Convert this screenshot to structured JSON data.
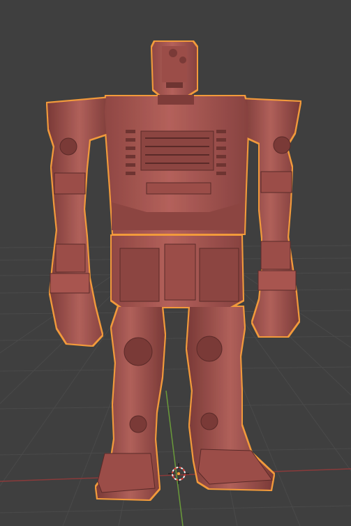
{
  "viewport": {
    "mode": "3d-viewport",
    "shading": "solid",
    "selected_object": "robot-model",
    "object_selected": true
  },
  "colors": {
    "background": "#3f3f3f",
    "grid_line": "#4a4a4a",
    "grid_line_light": "#525252",
    "axis_x": "#8a3a3a",
    "axis_y": "#6a9a3a",
    "model_base": "#a85a55",
    "model_light": "#c3716a",
    "model_dark": "#6e3431",
    "model_shadow": "#4f2422",
    "selection_outline": "#f29a3a",
    "cursor_red": "#e0413a",
    "cursor_white": "#f2f2f2"
  },
  "icons": {
    "scene_cursor": "3d-cursor-icon",
    "origin": "object-origin-icon"
  }
}
